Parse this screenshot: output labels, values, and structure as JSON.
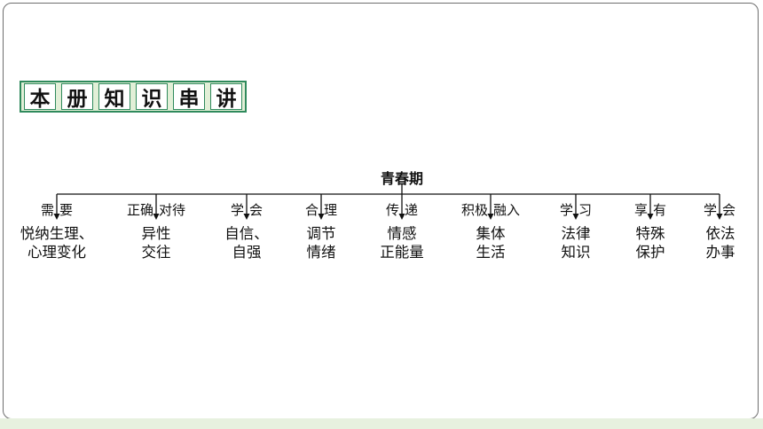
{
  "title_chars": [
    "本",
    "册",
    "知",
    "识",
    "串",
    "讲"
  ],
  "root": "青春期",
  "branches": [
    {
      "left": "需",
      "right": "要",
      "leaf": [
        "悦纳生理、",
        "心理变化"
      ]
    },
    {
      "left": "正确",
      "right": "对待",
      "leaf": [
        "异性",
        "交往"
      ]
    },
    {
      "left": "学",
      "right": "会",
      "leaf": [
        "自信、",
        "自强"
      ]
    },
    {
      "left": "合",
      "right": "理",
      "leaf": [
        "调节",
        "情绪"
      ]
    },
    {
      "left": "传",
      "right": "递",
      "leaf": [
        "情感",
        "正能量"
      ]
    },
    {
      "left": "积极",
      "right": "融入",
      "leaf": [
        "集体",
        "生活"
      ]
    },
    {
      "left": "学",
      "right": "习",
      "leaf": [
        "法律",
        "知识"
      ]
    },
    {
      "left": "享",
      "right": "有",
      "leaf": [
        "特殊",
        "保护"
      ]
    },
    {
      "left": "学",
      "right": "会",
      "leaf": [
        "依法",
        "办事"
      ]
    }
  ],
  "colors": {
    "accent_green": "#2f8a5c",
    "title_bg": "#e2efd7",
    "footer_band": "#e7f1df",
    "line": "#111111"
  }
}
